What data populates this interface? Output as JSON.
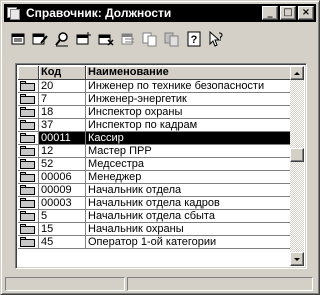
{
  "window": {
    "title": "Справочник: Должности",
    "controls": {
      "minimize_glyph": "_",
      "maximize_glyph": "□",
      "close_glyph": "×"
    }
  },
  "toolbar": {
    "tools": [
      {
        "icon": "new-item-icon"
      },
      {
        "icon": "edit-item-icon"
      },
      {
        "icon": "find-icon"
      },
      {
        "icon": "add-row-icon"
      },
      {
        "icon": "delete-row-icon"
      },
      {
        "icon": "move-icon"
      },
      {
        "icon": "copy-icon"
      },
      {
        "icon": "copy-group-icon"
      },
      {
        "icon": "help-icon"
      },
      {
        "icon": "context-help-icon"
      }
    ],
    "help_glyph": "?"
  },
  "grid": {
    "columns": [
      "",
      "Код",
      "Наименование"
    ],
    "rows": [
      {
        "code": "20",
        "name": "Инженер по технике безопасности"
      },
      {
        "code": "7",
        "name": "Инженер-энергетик"
      },
      {
        "code": "18",
        "name": "Инспектор охраны"
      },
      {
        "code": "37",
        "name": "Инспектор по кадрам"
      },
      {
        "code": "00011",
        "name": "Кассир",
        "selected": true
      },
      {
        "code": "12",
        "name": "Мастер ПРР"
      },
      {
        "code": "52",
        "name": "Медсестра"
      },
      {
        "code": "00006",
        "name": "Менеджер"
      },
      {
        "code": "00009",
        "name": "Начальник отдела"
      },
      {
        "code": "00003",
        "name": "Начальник отдела кадров"
      },
      {
        "code": "5",
        "name": "Начальник отдела сбыта"
      },
      {
        "code": "15",
        "name": "Начальник охраны"
      },
      {
        "code": "45",
        "name": "Оператор 1-ой категории"
      }
    ]
  }
}
